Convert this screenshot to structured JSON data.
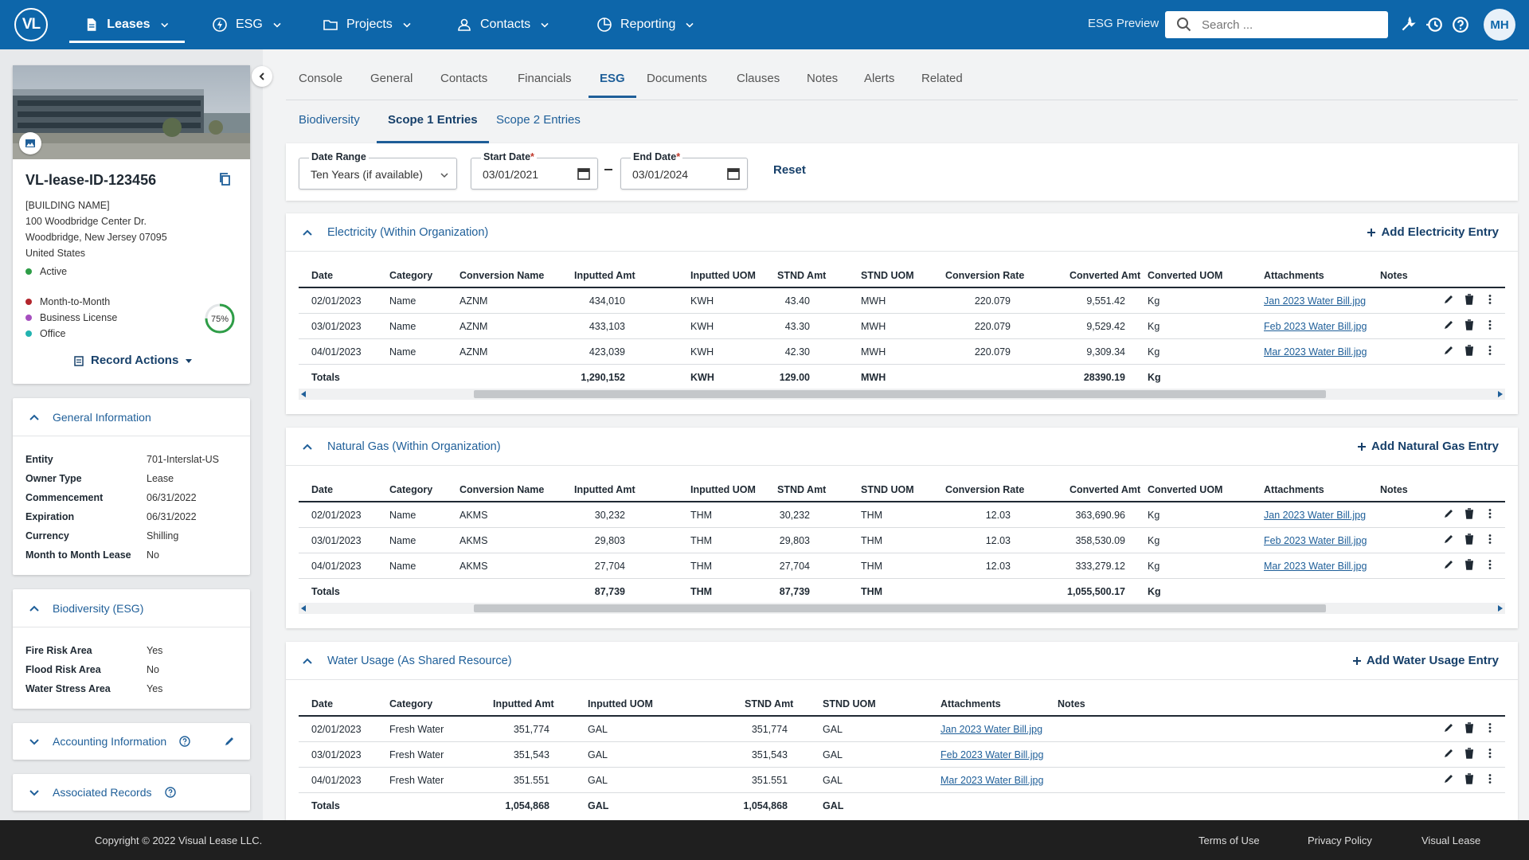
{
  "brand": {
    "logo": "VL"
  },
  "nav": {
    "items": [
      {
        "label": "Leases",
        "icon": "document-icon"
      },
      {
        "label": "ESG",
        "icon": "lightning-icon"
      },
      {
        "label": "Projects",
        "icon": "folder-icon"
      },
      {
        "label": "Contacts",
        "icon": "person-icon"
      },
      {
        "label": "Reporting",
        "icon": "pie-chart-icon"
      }
    ],
    "active": "Leases",
    "esg_preview": "ESG Preview",
    "search_placeholder": "Search ...",
    "user_initials": "MH"
  },
  "lease": {
    "id": "VL-lease-ID-123456",
    "building": "[BUILDING NAME]",
    "street": "100 Woodbridge Center Dr.",
    "city": "Woodbridge, New Jersey 07095",
    "country": "United States",
    "status": "Active",
    "tags": [
      {
        "label": "Month-to-Month",
        "color": "#b3262d"
      },
      {
        "label": "Business License",
        "color": "#a64fbf"
      },
      {
        "label": "Office",
        "color": "#22b3b0"
      }
    ],
    "progress": "75%",
    "progress_value": 0.75,
    "record_actions": "Record Actions"
  },
  "general": {
    "title": "General Information",
    "rows": [
      {
        "k": "Entity",
        "v": "701-Interslat-US"
      },
      {
        "k": "Owner Type",
        "v": "Lease"
      },
      {
        "k": "Commencement",
        "v": "06/31/2022"
      },
      {
        "k": "Expiration",
        "v": "06/31/2022"
      },
      {
        "k": "Currency",
        "v": "Shilling"
      },
      {
        "k": "Month to Month Lease",
        "v": "No"
      }
    ]
  },
  "biodiversity": {
    "title": "Biodiversity (ESG)",
    "rows": [
      {
        "k": "Fire Risk Area",
        "v": "Yes"
      },
      {
        "k": "Flood Risk Area",
        "v": "No"
      },
      {
        "k": "Water Stress Area",
        "v": "Yes"
      }
    ]
  },
  "accounting": {
    "title": "Accounting Information"
  },
  "associated": {
    "title": "Associated Records"
  },
  "tabs": [
    "Console",
    "General",
    "Contacts",
    "Financials",
    "ESG",
    "Documents",
    "Clauses",
    "Notes",
    "Alerts",
    "Related"
  ],
  "active_tab": "ESG",
  "subtabs": [
    "Biodiversity",
    "Scope 1 Entries",
    "Scope 2 Entries"
  ],
  "active_subtab": "Scope 1 Entries",
  "filters": {
    "date_range_label": "Date Range",
    "date_range_value": "Ten Years (if available)",
    "start_label": "Start Date",
    "start_value": "03/01/2021",
    "end_label": "End Date",
    "end_value": "03/01/2024",
    "required_mark": "*",
    "reset": "Reset"
  },
  "columns": [
    "Date",
    "Category",
    "Conversion Name",
    "Inputted Amt",
    "Inputted UOM",
    "STND Amt",
    "STND UOM",
    "Conversion Rate",
    "Converted Amt",
    "Converted UOM",
    "Attachments",
    "Notes"
  ],
  "electricity": {
    "title": "Electricity (Within Organization)",
    "add": "Add Electricity Entry",
    "rows": [
      [
        "02/01/2023",
        "Name",
        "AZNM",
        "434,010",
        "KWH",
        "43.40",
        "MWH",
        "220.079",
        "9,551.42",
        "Kg",
        "Jan 2023 Water Bill.jpg",
        ""
      ],
      [
        "03/01/2023",
        "Name",
        "AZNM",
        "433,103",
        "KWH",
        "43.30",
        "MWH",
        "220.079",
        "9,529.42",
        "Kg",
        "Feb 2023 Water Bill.jpg",
        ""
      ],
      [
        "04/01/2023",
        "Name",
        "AZNM",
        "423,039",
        "KWH",
        "42.30",
        "MWH",
        "220.079",
        "9,309.34",
        "Kg",
        "Mar 2023 Water Bill.jpg",
        ""
      ]
    ],
    "totals": [
      "Totals",
      "",
      "",
      "1,290,152",
      "KWH",
      "129.00",
      "MWH",
      "",
      "28390.19",
      "Kg",
      "",
      ""
    ]
  },
  "gas": {
    "title": "Natural Gas (Within Organization)",
    "add": "Add Natural Gas Entry",
    "rows": [
      [
        "02/01/2023",
        "Name",
        "AKMS",
        "30,232",
        "THM",
        "30,232",
        "THM",
        "12.03",
        "363,690.96",
        "Kg",
        "Jan 2023 Water Bill.jpg",
        ""
      ],
      [
        "03/01/2023",
        "Name",
        "AKMS",
        "29,803",
        "THM",
        "29,803",
        "THM",
        "12.03",
        "358,530.09",
        "Kg",
        "Feb 2023 Water Bill.jpg",
        ""
      ],
      [
        "04/01/2023",
        "Name",
        "AKMS",
        "27,704",
        "THM",
        "27,704",
        "THM",
        "12.03",
        "333,279.12",
        "Kg",
        "Mar 2023 Water Bill.jpg",
        ""
      ]
    ],
    "totals": [
      "Totals",
      "",
      "",
      "87,739",
      "THM",
      "87,739",
      "THM",
      "",
      "1,055,500.17",
      "Kg",
      "",
      ""
    ]
  },
  "water": {
    "title": "Water Usage (As Shared Resource)",
    "add": "Add  Water Usage Entry",
    "columns": [
      "Date",
      "Category",
      "Inputted Amt",
      "Inputted UOM",
      "STND Amt",
      "STND UOM",
      "Attachments",
      "Notes"
    ],
    "rows": [
      [
        "02/01/2023",
        "Fresh Water",
        "351,774",
        "GAL",
        "351,774",
        "GAL",
        "Jan 2023 Water Bill.jpg",
        ""
      ],
      [
        "03/01/2023",
        "Fresh Water",
        "351,543",
        "GAL",
        "351,543",
        "GAL",
        "Feb 2023 Water Bill.jpg",
        ""
      ],
      [
        "04/01/2023",
        "Fresh Water",
        "351.551",
        "GAL",
        "351.551",
        "GAL",
        "Mar 2023 Water Bill.jpg",
        ""
      ]
    ],
    "totals": [
      "Totals",
      "",
      "1,054,868",
      "GAL",
      "1,054,868",
      "GAL",
      "",
      ""
    ]
  },
  "footer": {
    "copyright": "Copyright © 2022 Visual Lease LLC.",
    "links": [
      "Terms of Use",
      "Privacy Policy",
      "Visual Lease"
    ]
  },
  "colors": {
    "primary": "#0d66aa",
    "link": "#1f5f99",
    "footer": "#1f1f1f"
  }
}
